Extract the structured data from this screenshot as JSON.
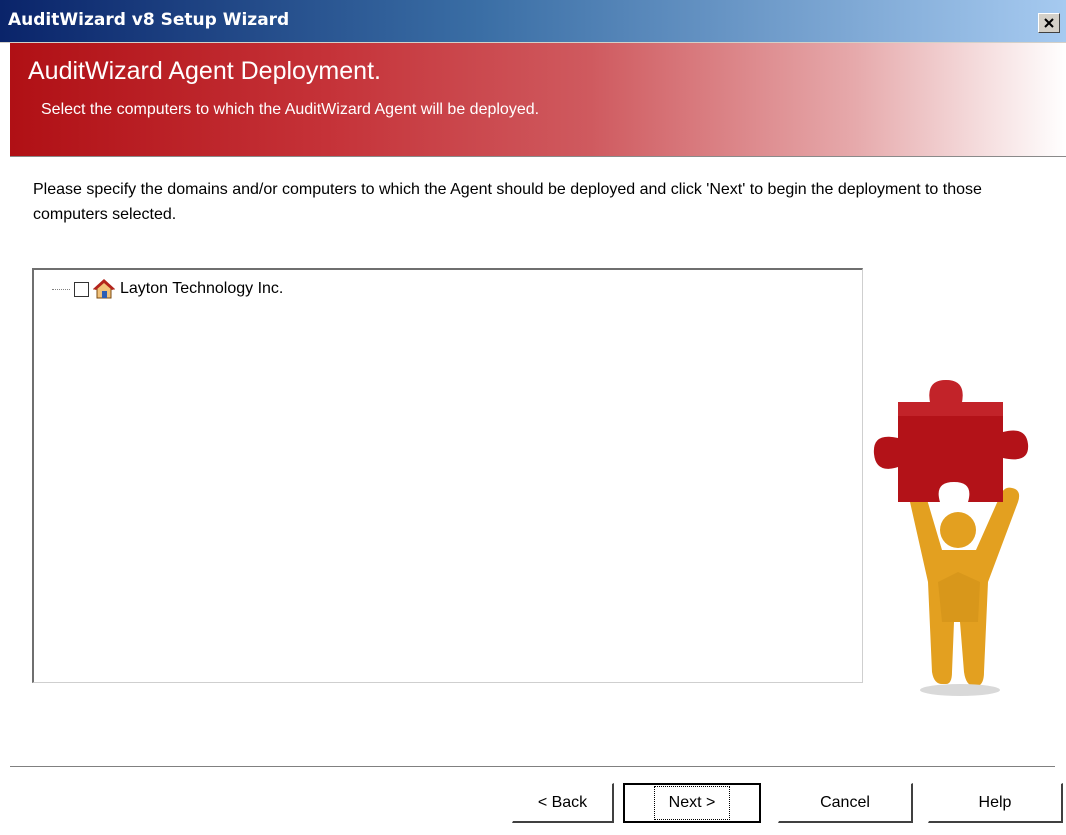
{
  "window": {
    "title": "AuditWizard v8 Setup Wizard",
    "close_glyph": "✕"
  },
  "banner": {
    "title": "AuditWizard Agent Deployment.",
    "subtitle": "Select the computers to which the AuditWizard Agent will be deployed."
  },
  "instructions": "Please specify the domains and/or computers to which the Agent should be deployed and click 'Next' to begin the deployment to those computers selected.",
  "tree": {
    "nodes": [
      {
        "label": "Layton Technology Inc.",
        "checked": false,
        "icon": "network-house-icon"
      }
    ]
  },
  "buttons": {
    "back": "< Back",
    "next": "Next >",
    "cancel": "Cancel",
    "help": "Help"
  },
  "colors": {
    "banner_red": "#b01015",
    "puzzle_red": "#b31218",
    "figure_orange": "#e3a020"
  }
}
